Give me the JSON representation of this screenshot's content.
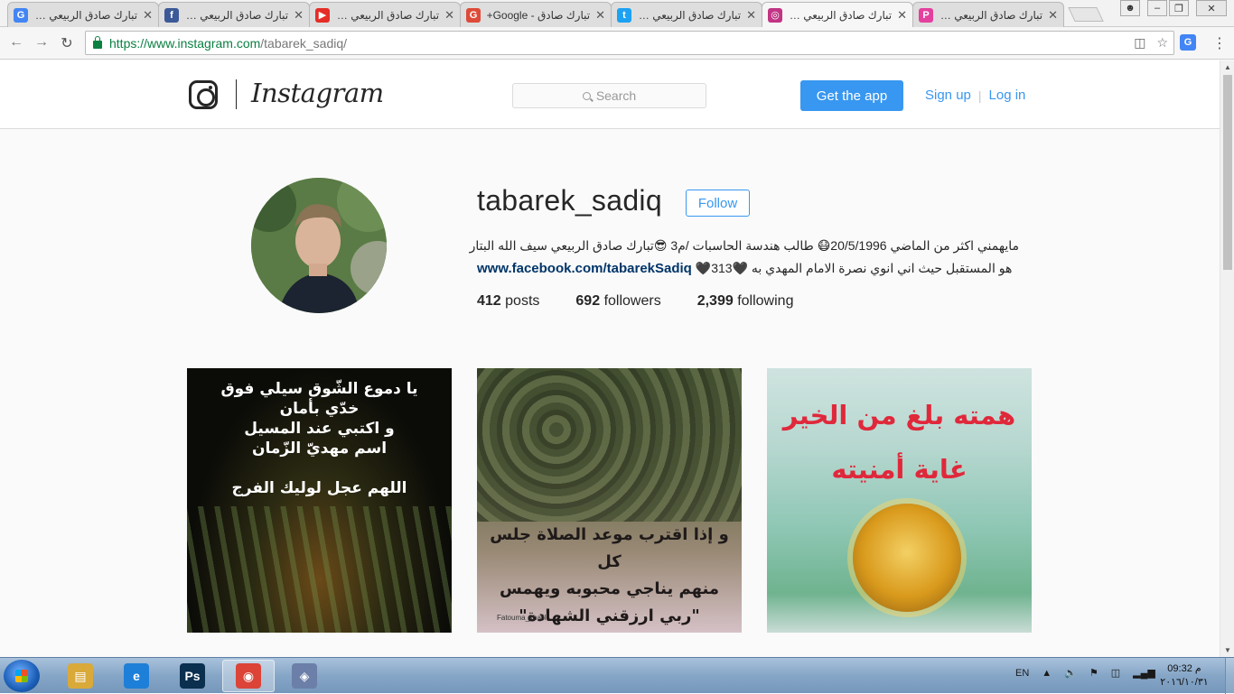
{
  "browser": {
    "tabs": [
      {
        "title": "تبارك صادق الربيعي - بحث",
        "favicon": "google-icon",
        "color": "#4285f4",
        "glyph": "G"
      },
      {
        "title": "تبارك صادق الربيعي | فيس",
        "favicon": "facebook-icon",
        "color": "#3b5998",
        "glyph": "f"
      },
      {
        "title": "تبارك صادق الربيعي - be",
        "favicon": "youtube-icon",
        "color": "#e52d27",
        "glyph": "▶"
      },
      {
        "title": "تبارك صادق - Google+",
        "favicon": "google-plus-icon",
        "color": "#dd4b39",
        "glyph": "G"
      },
      {
        "title": "تبارك صادق الربيعي (@",
        "favicon": "twitter-icon",
        "color": "#1da1f2",
        "glyph": "t"
      },
      {
        "title": "تبارك صادق الربيعي (@",
        "favicon": "instagram-icon",
        "color": "#c13584",
        "glyph": "◎"
      },
      {
        "title": "تبارك صادق الربيعي Art",
        "favicon": "picsart-icon",
        "color": "#e4409d",
        "glyph": "P"
      }
    ],
    "active_tab": 5,
    "url_host": "https://www.instagram.com",
    "url_path": "/tabarek_sadiq/"
  },
  "header": {
    "wordmark": "Instagram",
    "search_placeholder": "Search",
    "get_app_label": "Get the app",
    "signup_label": "Sign up",
    "separator": "|",
    "login_label": "Log in"
  },
  "profile": {
    "username": "tabarek_sadiq",
    "follow_label": "Follow",
    "bio_line1": "مايهمني اكثر من الماضي 20/5/1996😷 طالب هندسة الحاسبات /م3 😎تبارك صادق الربيعي سيف الله البتار",
    "bio_line2_text": "هو المستقبل حيث اني انوي نصرة الامام المهدي به 🖤313",
    "bio_link": "www.facebook.com/tabarekSadiq",
    "bio_heart": "🖤",
    "posts_count": "412",
    "posts_label": "posts",
    "followers_count": "692",
    "followers_label": "followers",
    "following_count": "2,399",
    "following_label": "following"
  },
  "posts": [
    {
      "lines": [
        "يا دموع الشّوق سيلي فوق",
        "خدّي بأمان",
        "و اكتبي عند المسيل",
        "اسم مهديّ الزّمان"
      ],
      "footer": "اللهم عجل لوليك الفرج"
    },
    {
      "lines": [
        "و إذا اقترب موعد الصلاة جلس كل",
        "منهم يناجي محبوبه ويهمس",
        "\"ربي ارزقني الشهادة\""
      ],
      "credit": "Fatouma_khalil"
    },
    {
      "lines": [
        "همته بلغ من الخير",
        "غاية أمنيته"
      ]
    }
  ],
  "taskbar": {
    "apps": [
      {
        "name": "file-explorer-icon",
        "glyph": "▤",
        "color": "#d9a93a"
      },
      {
        "name": "internet-explorer-icon",
        "glyph": "e",
        "color": "#1e7fd8"
      },
      {
        "name": "photoshop-icon",
        "glyph": "Ps",
        "color": "#0a2f4f"
      },
      {
        "name": "chrome-icon",
        "glyph": "◉",
        "color": "#db4437"
      },
      {
        "name": "app-window-icon",
        "glyph": "◈",
        "color": "#6b7fa8"
      }
    ],
    "language": "EN",
    "time": "09:32 م",
    "date": "٢٠١٦/١٠/٣١"
  }
}
